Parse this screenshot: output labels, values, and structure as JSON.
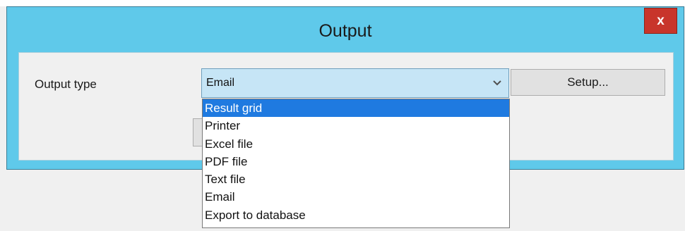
{
  "dialog": {
    "title": "Output",
    "close_label": "x"
  },
  "form": {
    "output_type_label": "Output type",
    "output_type_value": "Email",
    "setup_label": "Setup..."
  },
  "dropdown": {
    "options": [
      "Result grid",
      "Printer",
      "Excel file",
      "PDF file",
      "Text file",
      "Email",
      "Export to database"
    ],
    "highlighted": "Result grid"
  },
  "colors": {
    "title_bar": "#5fc9ea",
    "close_button": "#c8352b",
    "select_background": "#c6e5f6",
    "highlight": "#1f7ae0"
  },
  "icons": {
    "close": "close-icon",
    "select_arrow": "chevron-down-icon"
  }
}
